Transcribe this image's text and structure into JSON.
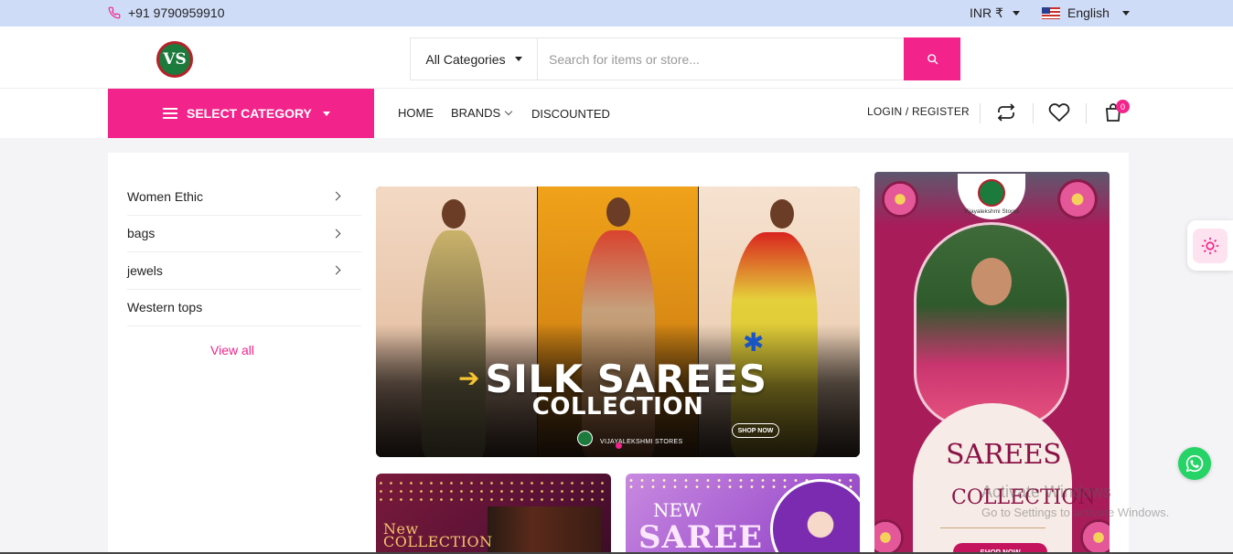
{
  "topbar": {
    "phone": "+91 9790959910",
    "currency": "INR ₹",
    "language": "English"
  },
  "header": {
    "logo_mark": "VS",
    "search": {
      "category": "All Categories",
      "placeholder": "Search for items or store..."
    }
  },
  "nav": {
    "select_category": "SELECT CATEGORY",
    "links": [
      "HOME",
      "BRANDS",
      "DISCOUNTED"
    ],
    "login": "LOGIN / REGISTER",
    "cart_count": "0"
  },
  "sidebar": {
    "items": [
      {
        "label": "Women Ethic",
        "has_sub": true
      },
      {
        "label": "bags",
        "has_sub": true
      },
      {
        "label": "jewels",
        "has_sub": true
      },
      {
        "label": "Western tops",
        "has_sub": false
      }
    ],
    "view_all": "View all"
  },
  "hero": {
    "title": "SILK SAREES",
    "subtitle": "COLLECTION",
    "brand": "VIJAYALEKSHMI STORES",
    "cta": "SHOP NOW"
  },
  "promo_a": {
    "line1": "New",
    "line2": "COLLECTION"
  },
  "promo_b": {
    "line1": "NEW",
    "line2": "SAREE"
  },
  "side_banner": {
    "store_name": "Vijayalekshmi Stores",
    "title": "SAREES",
    "subtitle": "COLLECTION",
    "cta": "SHOP NOW"
  },
  "watermark": {
    "line1": "Activate Windows",
    "line2": "Go to Settings to activate Windows."
  },
  "colors": {
    "accent": "#f2248b",
    "topbar_bg": "#cfdcf8",
    "whatsapp": "#25d366"
  }
}
